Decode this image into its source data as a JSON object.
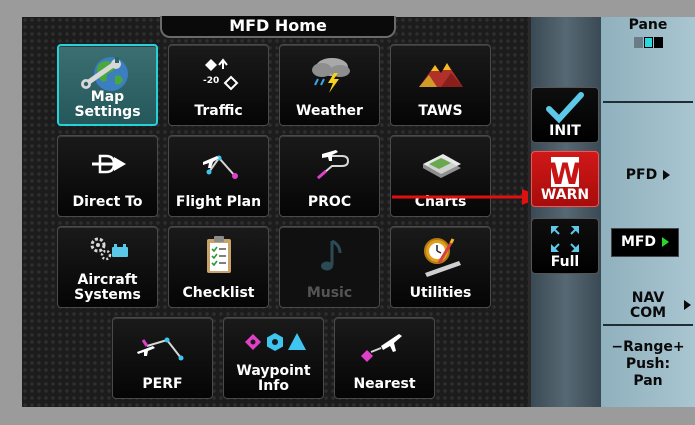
{
  "header": {
    "title": "MFD Home"
  },
  "buttons": [
    {
      "name": "map-settings",
      "label": "Map\nSettings",
      "icon": "map-settings-icon"
    },
    {
      "name": "traffic",
      "label": "Traffic",
      "icon": "traffic-icon",
      "icon_text": "-20"
    },
    {
      "name": "weather",
      "label": "Weather",
      "icon": "weather-icon"
    },
    {
      "name": "taws",
      "label": "TAWS",
      "icon": "taws-icon"
    },
    {
      "name": "direct-to",
      "label": "Direct To",
      "icon": "direct-to-icon"
    },
    {
      "name": "flight-plan",
      "label": "Flight Plan",
      "icon": "flight-plan-icon"
    },
    {
      "name": "proc",
      "label": "PROC",
      "icon": "proc-icon"
    },
    {
      "name": "charts",
      "label": "Charts",
      "icon": "charts-icon"
    },
    {
      "name": "aircraft-systems",
      "label": "Aircraft\nSystems",
      "icon": "aircraft-systems-icon"
    },
    {
      "name": "checklist",
      "label": "Checklist",
      "icon": "checklist-icon"
    },
    {
      "name": "music",
      "label": "Music",
      "icon": "music-icon",
      "state": "disabled"
    },
    {
      "name": "utilities",
      "label": "Utilities",
      "icon": "utilities-icon"
    },
    {
      "name": "perf",
      "label": "PERF",
      "icon": "perf-icon"
    },
    {
      "name": "waypoint-info",
      "label": "Waypoint\nInfo",
      "icon": "waypoint-info-icon"
    },
    {
      "name": "nearest",
      "label": "Nearest",
      "icon": "nearest-icon"
    }
  ],
  "selected_button": "map-settings",
  "side_strip": [
    {
      "name": "init",
      "label": "INIT",
      "icon": "checkmark-icon"
    },
    {
      "name": "warn",
      "label": "WARN",
      "icon": "warning-w-icon",
      "icon_text": "W",
      "color": "#c81414"
    },
    {
      "name": "full",
      "label": "Full",
      "icon": "expand-icon"
    }
  ],
  "softkeys": {
    "pane": "Pane",
    "pfd": "PFD",
    "mfd": "MFD",
    "nav_line1": "NAV",
    "nav_line2": "COM",
    "range_line1": "−Range+",
    "range_line2": "Push:",
    "range_line3": "Pan"
  },
  "colors": {
    "selected_border": "#26d2d8",
    "active_indicator": "#27d62b",
    "warn_red": "#c81414",
    "annotation_arrow": "#e01010",
    "softkey_bg": "#a2c0cb"
  }
}
